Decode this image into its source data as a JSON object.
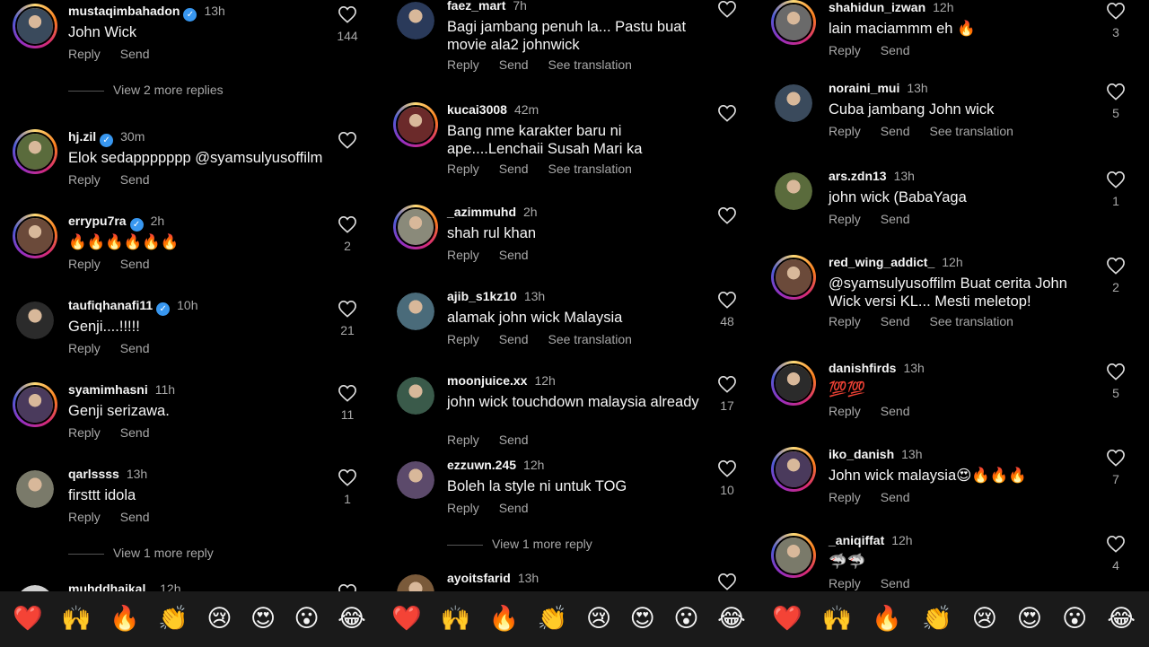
{
  "emoji_bar": [
    "❤️",
    "🙌",
    "🔥",
    "👏",
    "😢",
    "😍",
    "😮",
    "😂"
  ],
  "colors": {
    "background": "#000000",
    "text": "#f5f5f5",
    "muted": "#a8a8a8",
    "verified": "#3897f0",
    "emoji_bar_bg": "#1a1a1a"
  },
  "panels": [
    {
      "comments": [
        {
          "username": "mustaqimbahadon",
          "verified": true,
          "time": "13h",
          "text": "John Wick",
          "likes": "144",
          "actions": [
            "Reply",
            "Send"
          ],
          "story_ring": true,
          "view_more": "View 2 more replies"
        },
        {
          "username": "hj.zil",
          "verified": true,
          "time": "30m",
          "text": "Elok sedappppppp @syamsulyusoffilm",
          "likes": "",
          "actions": [
            "Reply",
            "Send"
          ],
          "story_ring": true
        },
        {
          "username": "errypu7ra",
          "verified": true,
          "time": "2h",
          "text": "🔥🔥🔥🔥🔥🔥",
          "likes": "2",
          "actions": [
            "Reply",
            "Send"
          ],
          "story_ring": true
        },
        {
          "username": "taufiqhanafi11",
          "verified": true,
          "time": "10h",
          "text": "Genji....!!!!!",
          "likes": "21",
          "actions": [
            "Reply",
            "Send"
          ],
          "story_ring": false
        },
        {
          "username": "syamimhasni",
          "verified": false,
          "time": "11h",
          "text": "Genji serizawa.",
          "likes": "11",
          "actions": [
            "Reply",
            "Send"
          ],
          "story_ring": true
        },
        {
          "username": "qarlssss",
          "verified": false,
          "time": "13h",
          "text": "firsttt idola",
          "likes": "1",
          "actions": [
            "Reply",
            "Send"
          ],
          "story_ring": false,
          "view_more": "View 1 more reply"
        },
        {
          "username": "muhddhaikal_",
          "verified": false,
          "time": "12h",
          "text": "",
          "likes": "",
          "actions": [],
          "story_ring": false
        }
      ]
    },
    {
      "comments": [
        {
          "username": "faez_mart",
          "verified": false,
          "time": "7h",
          "text": "Bagi jambang penuh la... Pastu buat movie ala2 johnwick",
          "likes": "",
          "actions": [
            "Reply",
            "Send",
            "See translation"
          ],
          "story_ring": false
        },
        {
          "username": "kucai3008",
          "verified": false,
          "time": "42m",
          "text": "Bang nme karakter baru ni ape....Lenchaii Susah Mari ka",
          "likes": "",
          "actions": [
            "Reply",
            "Send",
            "See translation"
          ],
          "story_ring": true
        },
        {
          "username": "_azimmuhd",
          "verified": false,
          "time": "2h",
          "text": "shah rul khan",
          "likes": "",
          "actions": [
            "Reply",
            "Send"
          ],
          "story_ring": true
        },
        {
          "username": "ajib_s1kz10",
          "verified": false,
          "time": "13h",
          "text": "alamak john wick Malaysia",
          "likes": "48",
          "actions": [
            "Reply",
            "Send",
            "See translation"
          ],
          "story_ring": false
        },
        {
          "username": "moonjuice.xx",
          "verified": false,
          "time": "12h",
          "text": "john wick touchdown malaysia already",
          "likes": "17",
          "actions": [
            "Reply",
            "Send"
          ],
          "story_ring": false
        },
        {
          "username": "ezzuwn.245",
          "verified": false,
          "time": "12h",
          "text": "Boleh la style ni untuk TOG",
          "likes": "10",
          "actions": [
            "Reply",
            "Send"
          ],
          "story_ring": false,
          "view_more": "View 1 more reply"
        },
        {
          "username": "ayoitsfarid",
          "verified": false,
          "time": "13h",
          "text": "",
          "likes": "",
          "actions": [],
          "story_ring": false
        }
      ]
    },
    {
      "comments": [
        {
          "username": "shahidun_izwan",
          "verified": false,
          "time": "12h",
          "text": "lain maciammm eh 🔥",
          "likes": "3",
          "actions": [
            "Reply",
            "Send"
          ],
          "story_ring": true
        },
        {
          "username": "noraini_mui",
          "verified": false,
          "time": "13h",
          "text": "Cuba jambang John wick",
          "likes": "5",
          "actions": [
            "Reply",
            "Send",
            "See translation"
          ],
          "story_ring": false
        },
        {
          "username": "ars.zdn13",
          "verified": false,
          "time": "13h",
          "text": "john wick (BabaYaga",
          "likes": "1",
          "actions": [
            "Reply",
            "Send"
          ],
          "story_ring": false
        },
        {
          "username": "red_wing_addict_",
          "verified": false,
          "time": "12h",
          "text": "@syamsulyusoffilm Buat cerita John Wick versi KL... Mesti meletop!",
          "likes": "2",
          "actions": [
            "Reply",
            "Send",
            "See translation"
          ],
          "story_ring": true
        },
        {
          "username": "danishfirds",
          "verified": false,
          "time": "13h",
          "text": "💯💯",
          "likes": "5",
          "actions": [
            "Reply",
            "Send"
          ],
          "story_ring": true
        },
        {
          "username": "iko_danish",
          "verified": false,
          "time": "13h",
          "text": "John wick malaysia😍🔥🔥🔥",
          "likes": "7",
          "actions": [
            "Reply",
            "Send"
          ],
          "story_ring": true
        },
        {
          "username": "_aniqiffat",
          "verified": false,
          "time": "12h",
          "text": "🦈🦈",
          "likes": "4",
          "actions": [
            "Reply",
            "Send"
          ],
          "story_ring": true
        }
      ]
    }
  ]
}
